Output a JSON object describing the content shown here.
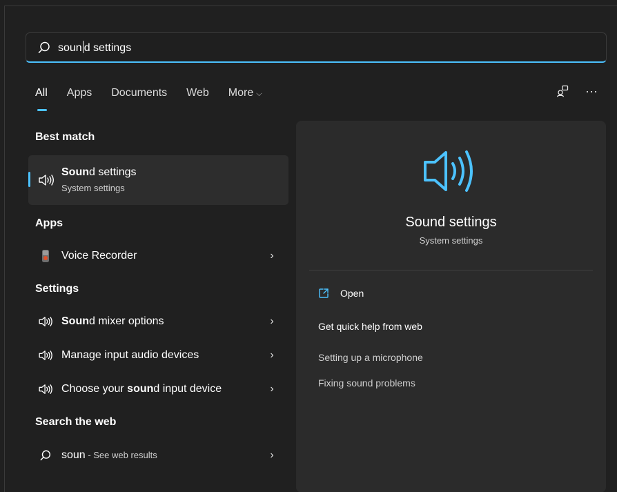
{
  "search": {
    "typed_before_caret": "soun",
    "typed_after_caret": "d settings"
  },
  "tabs": [
    {
      "label": "All",
      "active": true
    },
    {
      "label": "Apps"
    },
    {
      "label": "Documents"
    },
    {
      "label": "Web"
    },
    {
      "label": "More",
      "has_dropdown": true
    }
  ],
  "toolbar": {
    "account_icon": "account-icon",
    "more_icon": "more-options-icon",
    "more_glyph": "···",
    "chevron_down": "⌵"
  },
  "sections": {
    "best_match": "Best match",
    "apps": "Apps",
    "settings": "Settings",
    "search_web": "Search the web"
  },
  "best_match": {
    "title_bold": "Soun",
    "title_rest": "d settings",
    "subtitle": "System settings",
    "icon": "speaker-icon"
  },
  "apps": [
    {
      "label": "Voice Recorder",
      "icon": "voice-recorder-icon"
    }
  ],
  "settings": [
    {
      "prefix": "",
      "bold": "Soun",
      "suffix": "d mixer options",
      "icon": "speaker-icon"
    },
    {
      "prefix": "Manage input audio devices",
      "bold": "",
      "suffix": "",
      "icon": "speaker-icon"
    },
    {
      "prefix": "Choose your ",
      "bold": "soun",
      "suffix": "d input device",
      "icon": "speaker-icon"
    }
  ],
  "web": {
    "query": "soun",
    "suffix": " - See web results",
    "icon": "search-icon"
  },
  "chevron_right": "›",
  "detail": {
    "title": "Sound settings",
    "subtitle": "System settings",
    "open_label": "Open",
    "quick_help": "Get quick help from web",
    "links": [
      "Setting up a microphone",
      "Fixing sound problems"
    ]
  },
  "colors": {
    "accent": "#4cc2ff",
    "background": "#202020",
    "panel": "#2b2b2b",
    "selected": "#2d2d2d"
  }
}
